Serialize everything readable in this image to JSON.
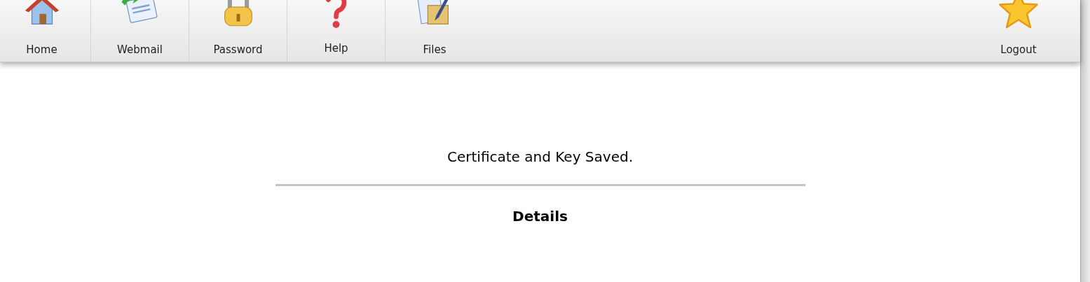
{
  "toolbar": {
    "items": [
      {
        "label": "Home",
        "kind": "home"
      },
      {
        "label": "Webmail",
        "kind": "mail"
      },
      {
        "label": "Password",
        "kind": "lock"
      },
      {
        "label": "Help",
        "kind": "help"
      },
      {
        "label": "Files",
        "kind": "files"
      }
    ],
    "right_items": [
      {
        "label": "Logout",
        "kind": "star"
      }
    ]
  },
  "message": "Certificate and Key Saved.",
  "details_heading": "Details"
}
